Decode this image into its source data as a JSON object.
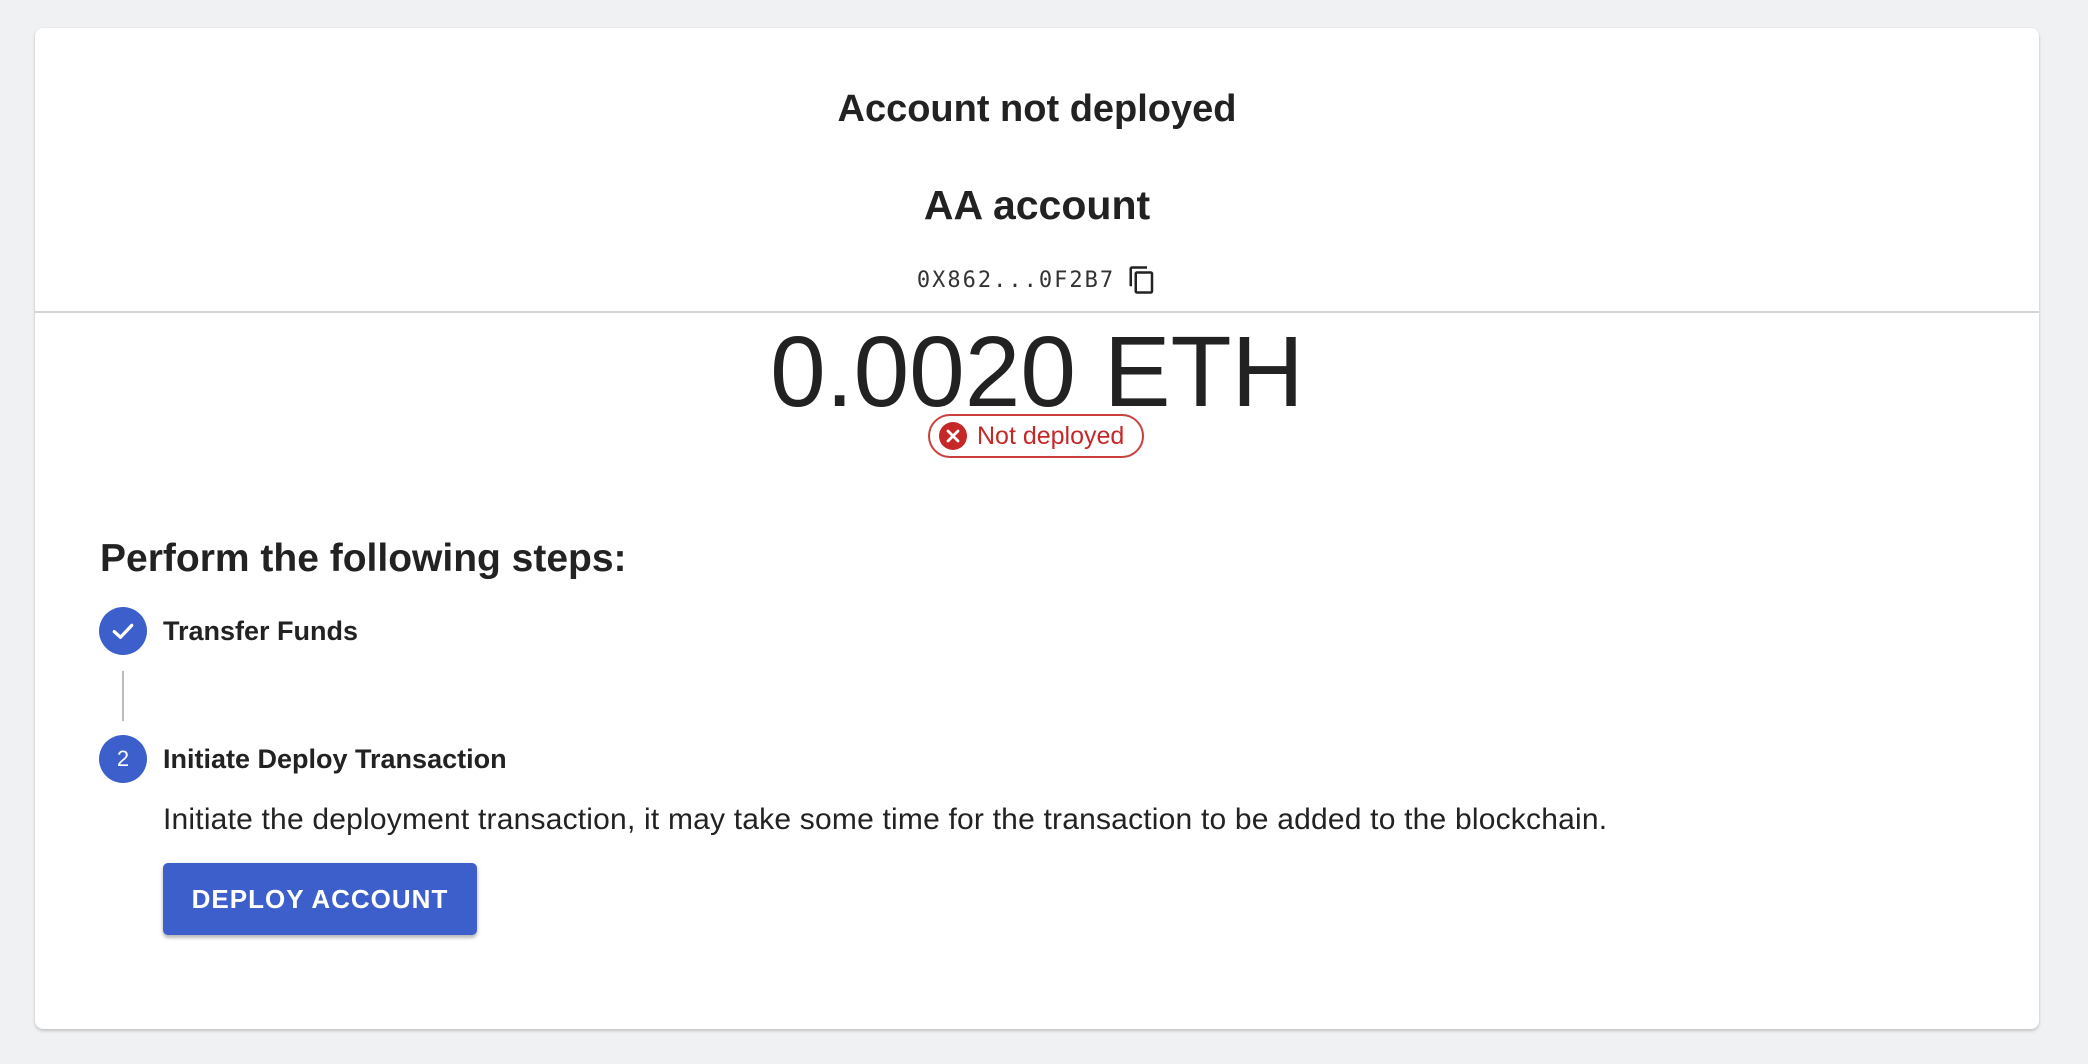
{
  "header": {
    "title": "Account not deployed"
  },
  "account": {
    "name": "AA account",
    "address_short": "0X862...0F2B7",
    "copy_icon": "content-copy-icon"
  },
  "balance": {
    "display": "0.0020 ETH"
  },
  "status": {
    "label": "Not deployed",
    "icon": "cancel-icon",
    "color": "#c62828"
  },
  "steps": {
    "heading": "Perform the following steps:",
    "items": [
      {
        "label": "Transfer Funds",
        "state": "completed",
        "icon": "check-icon"
      },
      {
        "label": "Initiate Deploy Transaction",
        "state": "active",
        "number": "2"
      }
    ],
    "active_description": "Initiate the deployment transaction, it may take some time for the transaction to be added to the blockchain.",
    "action_label": "DEPLOY ACCOUNT"
  },
  "colors": {
    "accent": "#3d5fcc",
    "error": "#c62828",
    "background": "#f0f1f3",
    "card": "#ffffff"
  }
}
